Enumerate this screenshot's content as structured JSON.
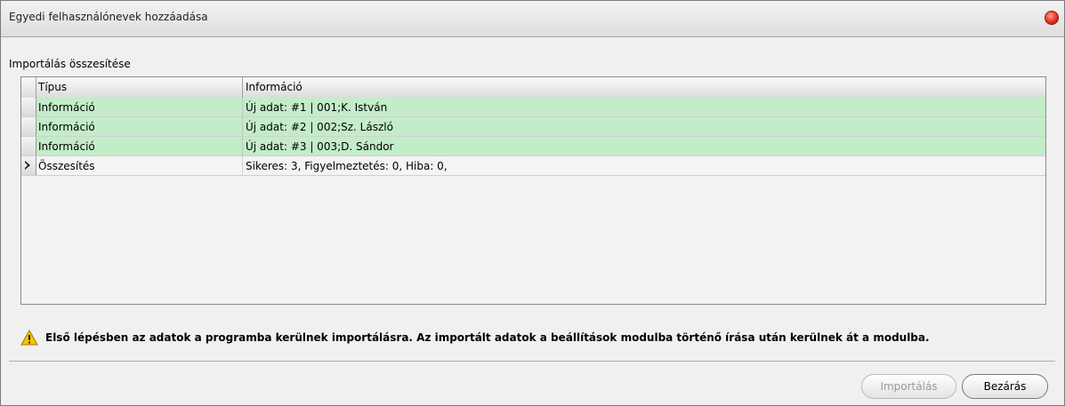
{
  "window": {
    "title": "Egyedi felhasználónevek hozzáadása"
  },
  "section_label": "Importálás összesítése",
  "table": {
    "columns": [
      "Típus",
      "Információ"
    ],
    "rows": [
      {
        "type": "Információ",
        "info": "Új adat: #1 | 001;K. István",
        "status": "info"
      },
      {
        "type": "Információ",
        "info": "Új adat: #2 | 002;Sz. László",
        "status": "info"
      },
      {
        "type": "Információ",
        "info": "Új adat: #3 | 003;D. Sándor",
        "status": "info"
      },
      {
        "type": "Összesítés",
        "info": "Sikeres: 3, Figyelmeztetés: 0, Hiba: 0,",
        "status": "summary",
        "current": true
      }
    ]
  },
  "warning": {
    "icon": "warning-icon",
    "text": "Első lépésben az adatok a programba kerülnek importálásra. Az importált adatok a beállítások modulba történő írása után kerülnek át a modulba."
  },
  "buttons": {
    "import_label": "Importálás",
    "import_enabled": false,
    "close_label": "Bezárás"
  },
  "colors": {
    "info_row": "#c3ecc9",
    "close_icon": "#e2341c",
    "warning_icon": "#f5c400"
  }
}
